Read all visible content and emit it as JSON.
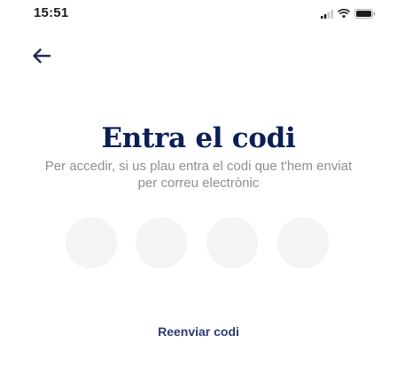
{
  "status_bar": {
    "time": "15:51",
    "icons": [
      "cellular-signal-icon",
      "wifi-icon",
      "battery-icon"
    ]
  },
  "navigation": {
    "back_icon": "back-arrow-icon"
  },
  "page": {
    "title": "Entra el codi",
    "subtitle": "Per accedir, si us plau entra el codi que t'hem enviat per correu electrònic"
  },
  "code_input": {
    "digits": [
      "",
      "",
      "",
      ""
    ]
  },
  "actions": {
    "resend_label": "Reenviar codi"
  },
  "colors": {
    "title": "#0b1f57",
    "subtitle": "#8e8e93",
    "digit_background": "#f4f4f6",
    "link": "#2f3a70"
  }
}
